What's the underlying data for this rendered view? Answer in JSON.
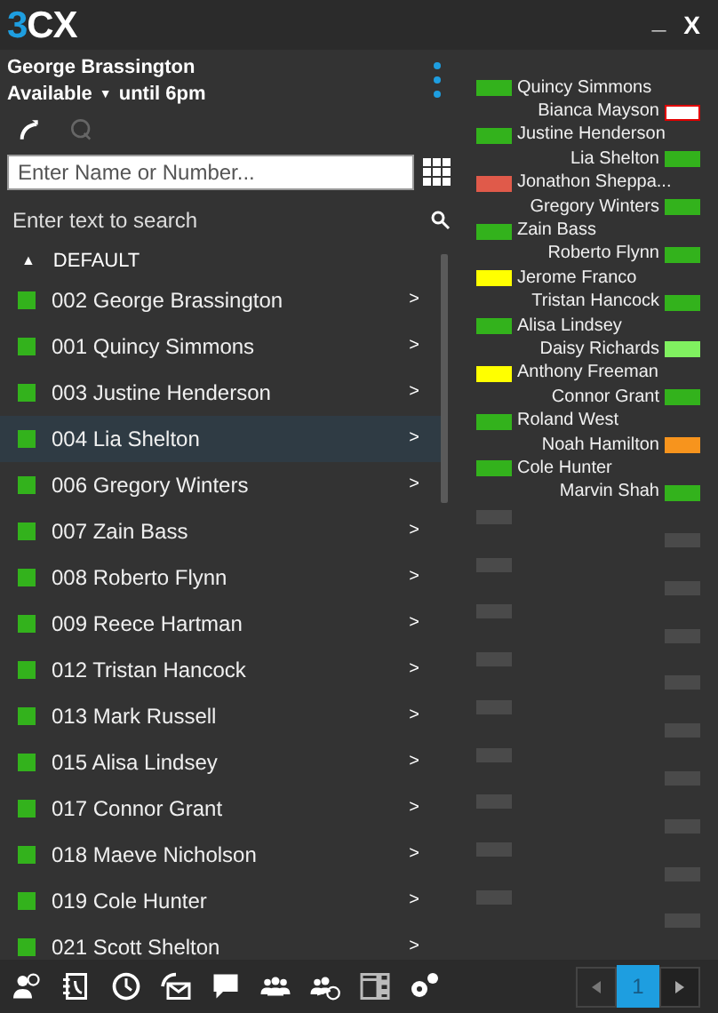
{
  "title_bar": {
    "logo": {
      "accent": "3",
      "rest": "CX"
    },
    "minimize": "_",
    "close": "X"
  },
  "user": {
    "name": "George Brassington",
    "status": "Available",
    "status_caret": "▼",
    "until": "until 6pm"
  },
  "dial": {
    "placeholder": "Enter Name or Number..."
  },
  "search": {
    "placeholder": "Enter text to search"
  },
  "group": {
    "caret": "▲",
    "name": "DEFAULT",
    "expanded": true
  },
  "contacts": [
    {
      "label": "002 George Brassington",
      "color": "#33b21c",
      "selected": false,
      "chevron": ">"
    },
    {
      "label": "001 Quincy Simmons",
      "color": "#33b21c",
      "selected": false,
      "chevron": ">"
    },
    {
      "label": "003 Justine Henderson",
      "color": "#33b21c",
      "selected": false,
      "chevron": ">"
    },
    {
      "label": "004 Lia Shelton",
      "color": "#33b21c",
      "selected": true,
      "chevron": ">"
    },
    {
      "label": "006 Gregory Winters",
      "color": "#33b21c",
      "selected": false,
      "chevron": ">"
    },
    {
      "label": "007 Zain Bass",
      "color": "#33b21c",
      "selected": false,
      "chevron": ">"
    },
    {
      "label": "008 Roberto Flynn",
      "color": "#33b21c",
      "selected": false,
      "chevron": ">"
    },
    {
      "label": "009 Reece Hartman",
      "color": "#33b21c",
      "selected": false,
      "chevron": ">"
    },
    {
      "label": "012 Tristan Hancock",
      "color": "#33b21c",
      "selected": false,
      "chevron": ">"
    },
    {
      "label": "013 Mark Russell",
      "color": "#33b21c",
      "selected": false,
      "chevron": ">"
    },
    {
      "label": "015 Alisa Lindsey",
      "color": "#33b21c",
      "selected": false,
      "chevron": ">"
    },
    {
      "label": "017 Connor Grant",
      "color": "#33b21c",
      "selected": false,
      "chevron": ">"
    },
    {
      "label": "018 Maeve Nicholson",
      "color": "#33b21c",
      "selected": false,
      "chevron": ">"
    },
    {
      "label": "019 Cole Hunter",
      "color": "#33b21c",
      "selected": false,
      "chevron": ">"
    },
    {
      "label": "021 Scott Shelton",
      "color": "#33b21c",
      "selected": false,
      "chevron": ">"
    }
  ],
  "presence": [
    {
      "name": "Quincy Simmons",
      "color": "#33b21c",
      "ring": false
    },
    {
      "name": "Bianca Mayson",
      "color": "#ffffff",
      "ring": true
    },
    {
      "name": "Justine Henderson",
      "color": "#33b21c",
      "ring": false
    },
    {
      "name": "Lia Shelton",
      "color": "#33b21c",
      "ring": false
    },
    {
      "name": "Jonathon Sheppa...",
      "color": "#e05a4a",
      "ring": false
    },
    {
      "name": "Gregory Winters",
      "color": "#33b21c",
      "ring": false
    },
    {
      "name": "Zain Bass",
      "color": "#33b21c",
      "ring": false
    },
    {
      "name": "Roberto Flynn",
      "color": "#33b21c",
      "ring": false
    },
    {
      "name": "Jerome Franco",
      "color": "#ffff00",
      "ring": false
    },
    {
      "name": "Tristan Hancock",
      "color": "#33b21c",
      "ring": false
    },
    {
      "name": "Alisa Lindsey",
      "color": "#33b21c",
      "ring": false
    },
    {
      "name": "Daisy Richards",
      "color": "#80f060",
      "ring": false
    },
    {
      "name": "Anthony Freeman",
      "color": "#ffff00",
      "ring": false
    },
    {
      "name": "Connor Grant",
      "color": "#33b21c",
      "ring": false
    },
    {
      "name": "Roland West",
      "color": "#33b21c",
      "ring": false
    },
    {
      "name": "Noah Hamilton",
      "color": "#f7941d",
      "ring": false
    },
    {
      "name": "Cole Hunter",
      "color": "#33b21c",
      "ring": false
    },
    {
      "name": "Marvin Shah",
      "color": "#33b21c",
      "ring": false
    }
  ],
  "pager": {
    "pages": [
      {
        "label": "1",
        "selected": true
      }
    ]
  }
}
